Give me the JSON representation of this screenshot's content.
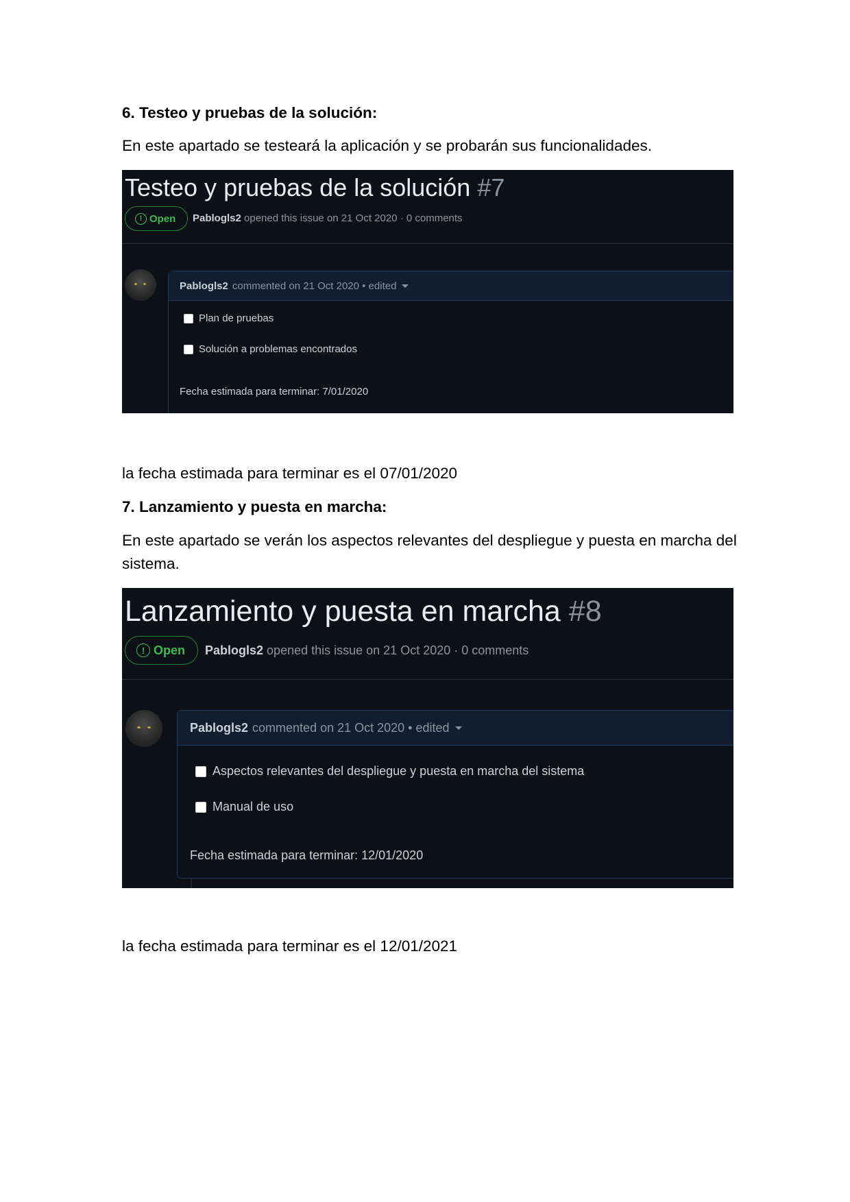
{
  "section6": {
    "heading": "6. Testeo y pruebas de la solución:",
    "intro": "En este apartado se testeará la aplicación y se probarán sus funcionalidades.",
    "issue": {
      "title": "Testeo y pruebas de la solución",
      "number": "#7",
      "status": "Open",
      "author": "Pablogls2",
      "opened_text": "opened this issue on 21 Oct 2020 · 0 comments",
      "comment_author": "Pablogls2",
      "comment_meta": "commented on 21 Oct 2020 • edited",
      "tasks": [
        "Plan de pruebas",
        "Solución a problemas encontrados"
      ],
      "due_text": "Fecha estimada para terminar: 7/01/2020"
    },
    "closing": "la fecha estimada para terminar es el 07/01/2020"
  },
  "section7": {
    "heading": "7. Lanzamiento y puesta en marcha:",
    "intro": "En este apartado se verán los aspectos relevantes del despliegue y puesta en marcha del sistema.",
    "issue": {
      "title": "Lanzamiento y puesta en marcha",
      "number": "#8",
      "status": "Open",
      "author": "Pablogls2",
      "opened_text": "opened this issue on 21 Oct 2020 · 0 comments",
      "comment_author": "Pablogls2",
      "comment_meta": "commented on 21 Oct 2020 • edited",
      "tasks": [
        "Aspectos relevantes del despliegue y puesta en marcha del sistema",
        "Manual de uso"
      ],
      "due_text": "Fecha estimada para terminar: 12/01/2020"
    },
    "closing": "la fecha estimada para terminar es el 12/01/2021"
  },
  "colors": {
    "screenshot_bg": "#0d1117",
    "open_green": "#3fb950",
    "comment_header_bg": "#121d2f"
  }
}
